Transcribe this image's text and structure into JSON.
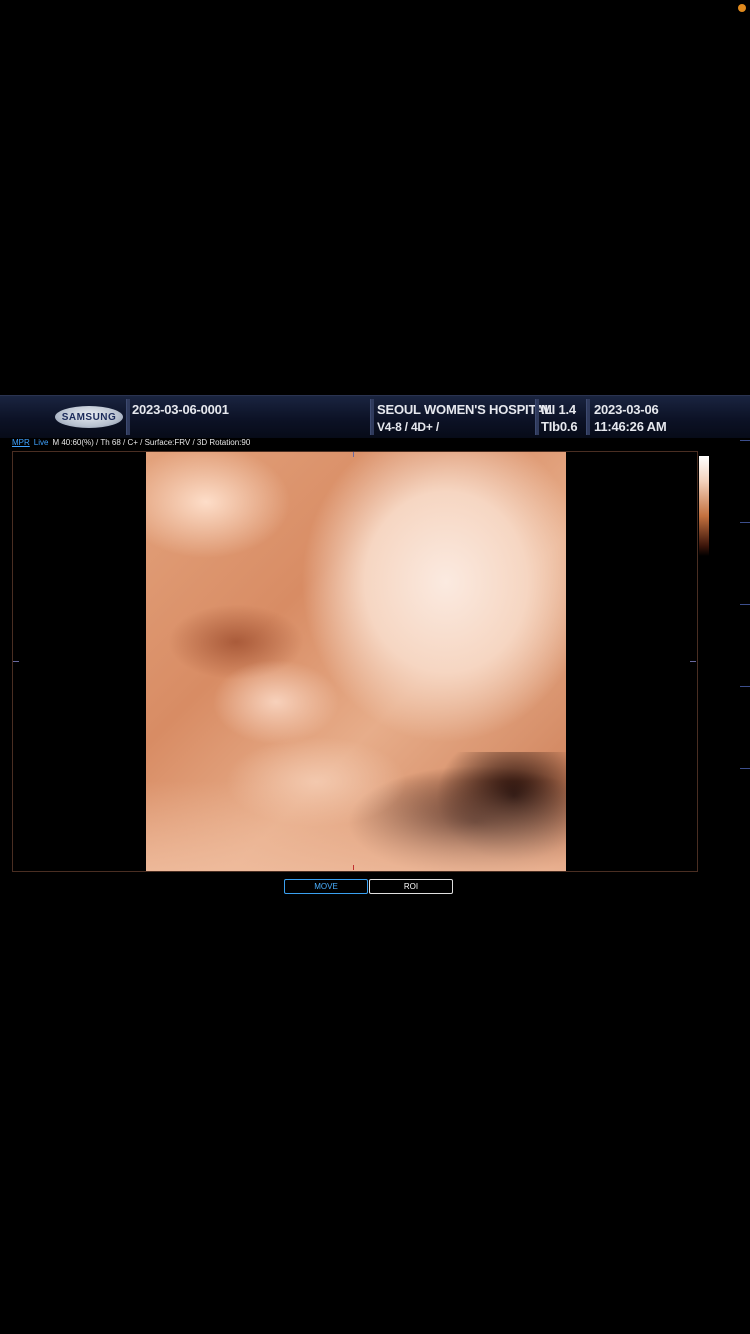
{
  "header": {
    "logo_text": "SAMSUNG",
    "patient_id": "2023-03-06-0001",
    "hospital": "SEOUL WOMEN'S HOSPITAL",
    "probe": "V4-8 / 4D+ /",
    "mi": "MI  1.4",
    "tib": "TIb0.6",
    "date": "2023-03-06",
    "time": "11:46:26 AM"
  },
  "infoline": {
    "mode_tab": "MPR",
    "live_tab": "Live",
    "params": "M 40:60(%) / Th 68 / C+ / Surface:FRV / 3D Rotation:90"
  },
  "buttons": {
    "move": "MOVE",
    "roi": "ROI"
  },
  "colors": {
    "accent_blue": "#3fa2ff",
    "header_bg": "#0c1226",
    "status_dot": "#e08a1e",
    "cursor_arrow": "#ffff40"
  }
}
